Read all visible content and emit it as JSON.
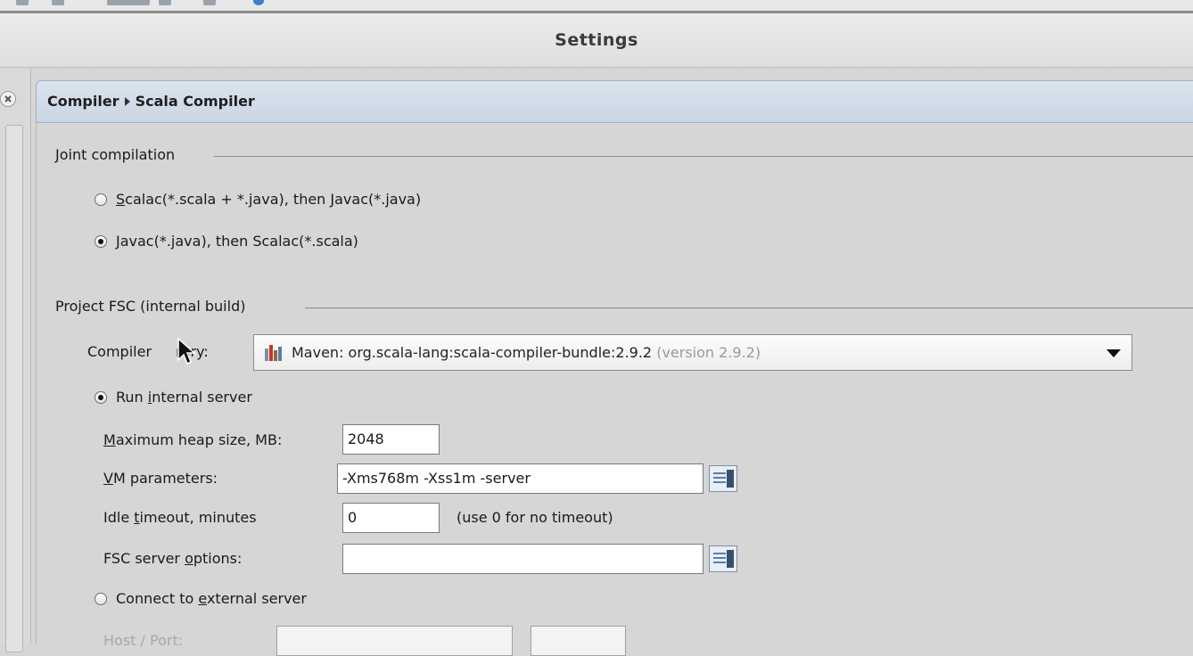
{
  "window": {
    "title": "Settings"
  },
  "breadcrumb": {
    "parent": "Compiler",
    "current": "Scala Compiler"
  },
  "joint_compilation": {
    "title": "Joint compilation",
    "options": [
      {
        "mnemonic": "S",
        "rest": "calac(*.scala + *.java), then Javac(*.java)",
        "selected": false
      },
      {
        "mnemonic": "J",
        "rest": "avac(*.java), then Scalac(*.scala)",
        "selected": true
      }
    ]
  },
  "project_fsc": {
    "title": "Project FSC (internal build)",
    "compiler_library_label": "Compiler library:",
    "compiler_library_label_visible_a": "Compiler ",
    "compiler_library_label_visible_b": "rary:",
    "compiler_library_value": "Maven: org.scala-lang:scala-compiler-bundle:2.9.2",
    "compiler_library_version": "(version 2.9.2)",
    "run_internal": {
      "pre": "Run ",
      "mnemonic": "i",
      "rest": "nternal server",
      "selected": true
    },
    "max_heap": {
      "mnemonic": "M",
      "rest": "aximum heap size, MB:",
      "value": "2048"
    },
    "vm_params": {
      "mnemonic": "V",
      "rest": "M parameters:",
      "value": "-Xms768m -Xss1m -server"
    },
    "idle_timeout": {
      "pre": "Idle ",
      "mnemonic": "t",
      "rest": "imeout, minutes",
      "value": "0",
      "hint": "(use 0 for no timeout)"
    },
    "fsc_options": {
      "pre": "FSC server ",
      "mnemonic": "o",
      "rest": "ptions:",
      "value": ""
    },
    "connect_external": {
      "pre": "Connect to ",
      "mnemonic": "e",
      "rest": "xternal server",
      "selected": false
    },
    "host_port_label": "Host / Port:",
    "host_value": "",
    "port_value": ""
  },
  "colors": {
    "header_bg": "#c9d6e3",
    "panel_bg": "#d6d6d6",
    "field_bg": "#ffffff"
  }
}
